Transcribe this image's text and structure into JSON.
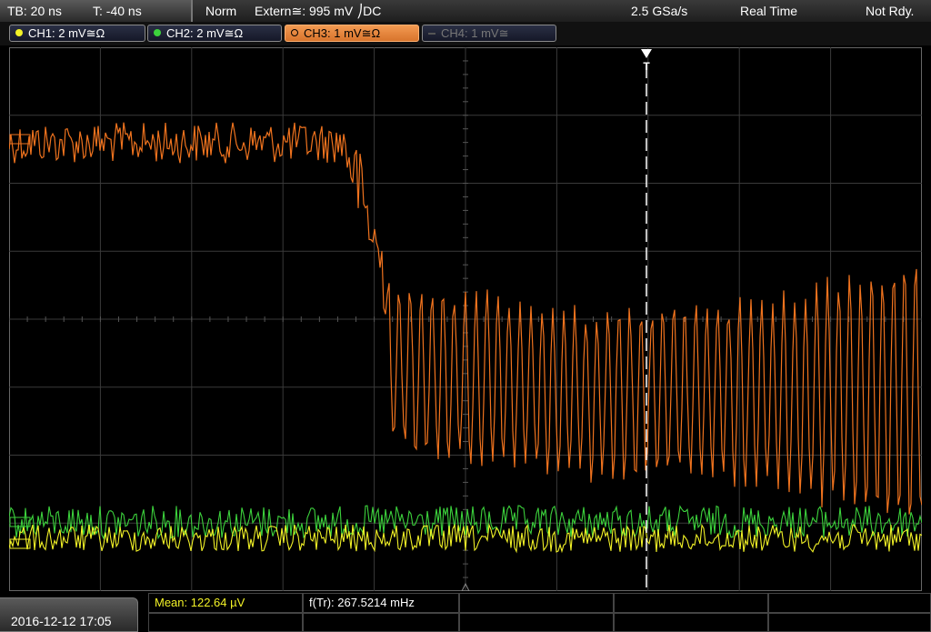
{
  "topbar": {
    "timebase": "TB: 20 ns",
    "trigger_offset": "T: -40 ns",
    "trigger_mode": "Norm",
    "trigger_source": "Extern≅: 995 mV ⎠DC",
    "sample_rate": "2.5 GSa/s",
    "acq_mode": "Real Time",
    "status": "Not Rdy."
  },
  "channels": [
    {
      "label": "CH1: 2 mV≅Ω",
      "color": "#f2f227",
      "state": "on"
    },
    {
      "label": "CH2: 2 mV≅Ω",
      "color": "#3cd23c",
      "state": "on"
    },
    {
      "label": "CH3: 1 mV≅Ω",
      "color": "#f0731e",
      "state": "active"
    },
    {
      "label": "CH4: 1 mV≅",
      "color": "#777777",
      "state": "off"
    }
  ],
  "trigger_marker": "T",
  "measurements": {
    "mean": "Mean: 122.64 µV",
    "freq": "f(Tr): 267.5214 mHz"
  },
  "datetime": "2016-12-12 17:05",
  "colors": {
    "grid": "#3a3a3a",
    "ch1": "#f2f227",
    "ch2": "#3cd23c",
    "ch3": "#f0731e"
  }
}
